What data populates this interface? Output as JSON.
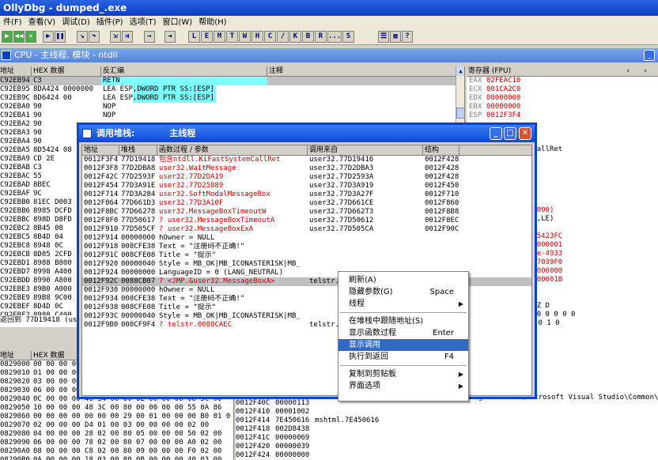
{
  "app": {
    "title": "OllyDbg - dumped_.exe"
  },
  "menu": [
    "件(F)",
    "查看(V)",
    "调试(D)",
    "插件(P)",
    "选项(T)",
    "窗口(W)",
    "帮助(H)"
  ],
  "toolbar": {
    "letters": [
      "L",
      "E",
      "M",
      "T",
      "W",
      "H",
      "C",
      "/",
      "K",
      "B",
      "R",
      "...",
      "S"
    ]
  },
  "cpu_window": {
    "title": "CPU - 主线程, 模块 - ntdll",
    "disasm_headers": [
      "地址",
      "HEX 数据",
      "反汇编",
      "注释"
    ],
    "disasm_rows": [
      [
        "C92EB94",
        "C3",
        "RETN"
      ],
      [
        "C92EB95",
        "8DA424 0000000",
        "LEA ESP,DWORD PTR SS:[ESP]"
      ],
      [
        "C92EB9C",
        "8D6424 00",
        "LEA ESP,DWORD PTR SS:[ESP]"
      ],
      [
        "C92EBA0",
        "90",
        "NOP"
      ],
      [
        "C92EBA1",
        "90",
        "NOP"
      ],
      [
        "C92EBA2",
        "90",
        ""
      ],
      [
        "C92EBA3",
        "90",
        ""
      ],
      [
        "C92EBA4",
        "90",
        ""
      ],
      [
        "C92EBA5",
        "8D5424 08",
        ""
      ],
      [
        "C92EBA9",
        "CD 2E",
        ""
      ],
      [
        "C92EBAB",
        "C3",
        ""
      ],
      [
        "C92EBAC",
        "55",
        ""
      ],
      [
        "C92EBAD",
        "8BEC",
        ""
      ],
      [
        "C92EBAF",
        "9C",
        ""
      ],
      [
        "C92EBB0",
        "81EC D003",
        ""
      ],
      [
        "C92EBB6",
        "8985 DCFD",
        ""
      ],
      [
        "C92EBBC",
        "898D D8FD",
        ""
      ],
      [
        "C92EBC2",
        "8B45 08",
        ""
      ],
      [
        "C92EBC5",
        "8B4D 04",
        ""
      ],
      [
        "C92EBC8",
        "8948 0C",
        ""
      ],
      [
        "C92EBCB",
        "8D85 2CFD",
        ""
      ],
      [
        "C92EBD1",
        "8988 B800",
        ""
      ],
      [
        "C92EBD7",
        "8998 A400",
        ""
      ],
      [
        "C92EBDD",
        "8990 A800",
        ""
      ],
      [
        "C92EBE3",
        "89B0 A000",
        ""
      ],
      [
        "C92EBE9",
        "89B8 9C00",
        ""
      ],
      [
        "C92EBEF",
        "8D4D 0C",
        ""
      ],
      [
        "C92EBF2",
        "8988 C400",
        ""
      ]
    ],
    "return_info": "返回到 77D19418 (use",
    "registers_header": "寄存器 (FPU)",
    "registers": [
      {
        "name": "EAX",
        "value": "02FEAC10"
      },
      {
        "name": "ECX",
        "value": "001CA2C0"
      },
      {
        "name": "EDX",
        "value": "00000000"
      },
      {
        "name": "EBX",
        "value": "00000000"
      },
      {
        "name": "ESP",
        "value": "0012F3F4"
      }
    ],
    "register_right": [
      "l1.KiFastSystemCallRet",
      " 0(FFFFFFFF)",
      " 0(FFFFFFFF)",
      " 0(FFFFFFFF)",
      " 0(FFFFFFFF)",
      " 7FFDF000(FFF)",
      "",
      "R_SUCCESS (00000000)",
      "NB,E,BE,NS,PE,GE,LE)",
      "",
      "00A0 00000006 805423FC",
      "EB94 0012F280 00000001",
      "6457997105488360e-4933",
      "0020 0000003B BA7039F0",
      "003B 0012F358 00000000",
      "F350 00200202 0000001B",
      "0000000000000000",
      "0000000000000000",
      "2 1 0      E S P U O Z D",
      "0 0 0   Err 0 0 1 0 0 0 0 0",
      "AR,53  掩码    1 1 0 0 1 0"
    ],
    "dump_headers": [
      "地址",
      "HEX 数据"
    ],
    "dump_rows": [
      [
        "0829000",
        "00 00 00 00"
      ],
      [
        "0829010",
        "01 00 00 00"
      ],
      [
        "0829020",
        "03 00 00 00"
      ],
      [
        "0829030",
        "06 00 00 00"
      ],
      [
        "0829040",
        "0C 00 00 00 48 34 00 80 0E 00 00 00 08 3C 00"
      ],
      [
        "0829050",
        "10 00 00 00 48 3C 00 80 00 00 00 00 55 0A 86"
      ],
      [
        "0829060",
        "00 00 00 00 00 00 00 29 00 01 00 00 00 B0 01 00"
      ],
      [
        "0829070",
        "02 00 00 00 D4 01 00 03 00 00 00 00 02 00"
      ],
      [
        "0829080",
        "04 00 00 00 28 02 00 80 05 00 00 00 50 02 00"
      ],
      [
        "0829090",
        "06 00 00 00 78 02 00 80 07 00 00 00 A0 02 00"
      ],
      [
        "08290A0",
        "08 00 00 00 C8 02 00 80 09 00 00 00 F0 02 00"
      ],
      [
        "08290B0",
        "0A 00 00 00 18 03 00 80 0B 00 00 00 40 03 00"
      ]
    ],
    "stack_rows": [
      [
        "0012F408",
        "0020050A",
        "UNICO"
      ],
      [
        "0012F40C",
        "00000113",
        ""
      ],
      [
        "0012F410",
        "00001002",
        ""
      ],
      [
        "0012F414",
        "7E450616",
        "mshtml.7E450616"
      ],
      [
        "0012F418",
        "002D8438",
        ""
      ],
      [
        "0012F41C",
        "00000069",
        ""
      ],
      [
        "0012F420",
        "00000039",
        ""
      ],
      [
        "0012F424",
        "00000000",
        ""
      ]
    ],
    "path_text": "rogram Files\\Microsoft Visual Studio\\Common\\"
  },
  "call_stack": {
    "title": "调用堆栈:",
    "thread": "主线程",
    "headers": [
      "地址",
      "堆栈",
      "函数过程 / 参数",
      "调用来自",
      "结构"
    ],
    "rows": [
      {
        "addr": "0012F3F4",
        "stack": "77D19418",
        "proc": "包含ntdll.KiFastSystemCallRet",
        "from": "user32.77D19416",
        "frame": "0012F428",
        "kind": "red"
      },
      {
        "addr": "0012F3F8",
        "stack": "77D2DBA8",
        "proc": "user32.WaitMessage",
        "from": "user32.77D2DBA3",
        "frame": "0012F428",
        "kind": "red"
      },
      {
        "addr": "0012F42C",
        "stack": "77D2593F",
        "proc": "user32.77D2DA19",
        "from": "user32.77D2593A",
        "frame": "0012F428",
        "kind": "red"
      },
      {
        "addr": "0012F454",
        "stack": "77D3A91E",
        "proc": "user32.77D25889",
        "from": "user32.77D3A919",
        "frame": "0012F450",
        "kind": "red"
      },
      {
        "addr": "0012F714",
        "stack": "77D3A284",
        "proc": "user32.SoftModalMessageBox",
        "from": "user32.77D3A27F",
        "frame": "0012F710",
        "kind": "red"
      },
      {
        "addr": "0012F864",
        "stack": "77D661D3",
        "proc": "user32.77D3A10F",
        "from": "user32.77D661CE",
        "frame": "0012F860",
        "kind": "red"
      },
      {
        "addr": "0012F8BC",
        "stack": "77D66278",
        "proc": "user32.MessageBoxTimeoutW",
        "from": "user32.77D662T3",
        "frame": "0012F8B8",
        "kind": "red"
      },
      {
        "addr": "0012F8F0",
        "stack": "77D50617",
        "proc": "? user32.MessageBoxTimeoutA",
        "from": "user32.77D50612",
        "frame": "0012F8EC",
        "kind": "red"
      },
      {
        "addr": "0012F910",
        "stack": "77D505CF",
        "proc": "? user32.MessageBoxExA",
        "from": "user32.77D505CA",
        "frame": "0012F90C",
        "kind": "red"
      },
      {
        "addr": "0012F914",
        "stack": "00000000",
        "proc": "  hOwner = NULL",
        "from": "",
        "frame": "",
        "kind": "plain"
      },
      {
        "addr": "0012F918",
        "stack": "008CFE38",
        "proc": "  Text = \"注册码不正确!\"",
        "from": "",
        "frame": "",
        "kind": "plain"
      },
      {
        "addr": "0012F91C",
        "stack": "008CFE08",
        "proc": "  Title = \"提示\"",
        "from": "",
        "frame": "",
        "kind": "plain"
      },
      {
        "addr": "0012F920",
        "stack": "00000040",
        "proc": "  Style = MB_OK|MB_ICONASTERISK|MB_",
        "from": "",
        "frame": "",
        "kind": "plain"
      },
      {
        "addr": "0012F924",
        "stack": "00000000",
        "proc": "  LanguageID = 0 (LANG_NEUTRAL)",
        "from": "",
        "frame": "",
        "kind": "plain"
      },
      {
        "addr": "0012F92C",
        "stack": "0088CB07",
        "proc": "? <JMP.&user32.MessageBoxA>",
        "from": "telstr.",
        "frame": "",
        "kind": "sel"
      },
      {
        "addr": "0012F930",
        "stack": "00000000",
        "proc": "  hOwner = NULL",
        "from": "",
        "frame": "",
        "kind": "plain"
      },
      {
        "addr": "0012F934",
        "stack": "008CFE38",
        "proc": "  Text = \"注册码不正确!\"",
        "from": "",
        "frame": "",
        "kind": "plain"
      },
      {
        "addr": "0012F938",
        "stack": "008CFE08",
        "proc": "  Title = \"提示\"",
        "from": "",
        "frame": "",
        "kind": "plain"
      },
      {
        "addr": "0012F93C",
        "stack": "00000040",
        "proc": "  Style = MB_OK|MB_ICONASTERISK|MB_",
        "from": "",
        "frame": "",
        "kind": "plain"
      },
      {
        "addr": "0012F9B0",
        "stack": "008CF9F4",
        "proc": "? telstr.0088CAEC",
        "from": "telstr.",
        "frame": "",
        "kind": "red"
      }
    ]
  },
  "context_menu": {
    "items": [
      {
        "label": "刷新(A)",
        "shortcut": "",
        "arrow": false,
        "selected": false
      },
      {
        "label": "隐藏参数(G)",
        "shortcut": "Space",
        "arrow": false,
        "selected": false
      },
      {
        "label": "线程",
        "shortcut": "",
        "arrow": true,
        "selected": false
      },
      {
        "sep": true
      },
      {
        "label": "在堆栈中跟随地址(S)",
        "shortcut": "",
        "arrow": false,
        "selected": false
      },
      {
        "label": "显示函数过程",
        "shortcut": "Enter",
        "arrow": false,
        "selected": false
      },
      {
        "label": "显示调用",
        "shortcut": "",
        "arrow": false,
        "selected": true
      },
      {
        "label": "执行到返回",
        "shortcut": "F4",
        "arrow": false,
        "selected": false
      },
      {
        "sep": true
      },
      {
        "label": "复制到剪贴板",
        "shortcut": "",
        "arrow": true,
        "selected": false
      },
      {
        "label": "界面选项",
        "shortcut": "",
        "arrow": true,
        "selected": false
      }
    ]
  },
  "colors": {
    "title": "#0b3fc2",
    "selected": "#316ac5",
    "red_text": "#d00000",
    "blue_text": "#0000c0"
  }
}
